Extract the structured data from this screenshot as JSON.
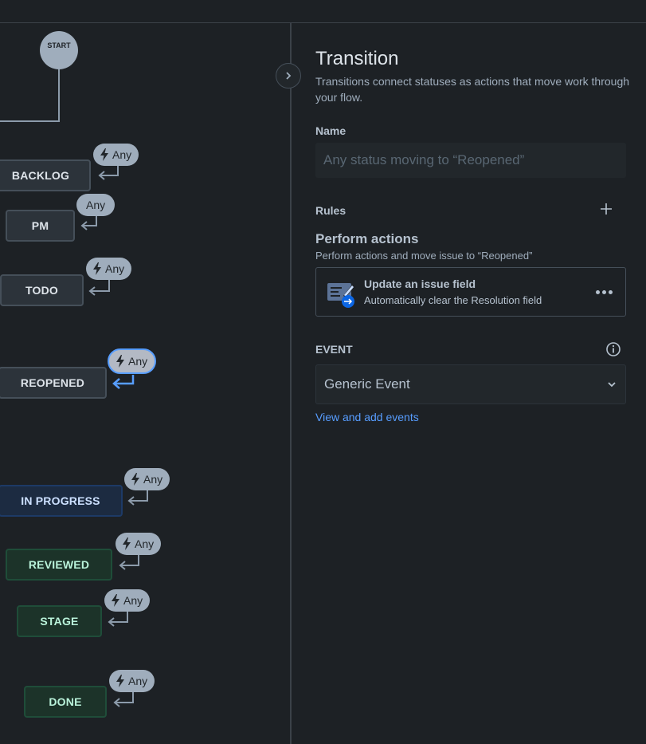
{
  "workflow": {
    "start_label": "START",
    "any_label": "Any",
    "statuses": {
      "backlog": "BACKLOG",
      "pm": "PM",
      "todo": "TODO",
      "reopened": "REOPENED",
      "in_progress": "IN PROGRESS",
      "reviewed": "REVIEWED",
      "stage": "STAGE",
      "done": "DONE"
    }
  },
  "panel": {
    "title": "Transition",
    "description": "Transitions connect statuses as actions that move work through your flow.",
    "name_label": "Name",
    "name_placeholder": "Any status moving to “Reopened”",
    "rules_label": "Rules",
    "perform_title": "Perform actions",
    "perform_subtitle": "Perform actions and move issue to “Reopened”",
    "action": {
      "title": "Update an issue field",
      "subtitle": "Automatically clear the Resolution field"
    },
    "event_label": "EVENT",
    "event_value": "Generic Event",
    "event_link": "View and add events"
  },
  "colors": {
    "background": "#1d2125",
    "accent": "#579dff",
    "status_green_text": "#baf3db",
    "status_blue_text": "#cce0ff"
  }
}
